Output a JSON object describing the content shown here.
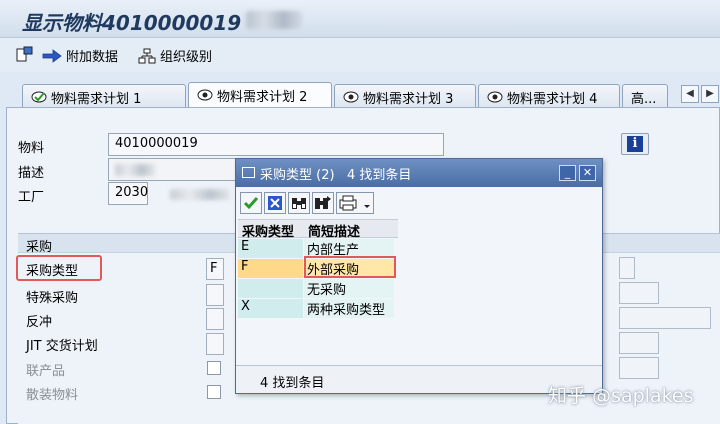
{
  "window": {
    "title": "显示物料4010000019"
  },
  "toolbar": {
    "items": [
      "附加数据",
      "组织级别"
    ]
  },
  "tabs": [
    "物料需求计划 1",
    "物料需求计划 2",
    "物料需求计划 3",
    "物料需求计划 4",
    "高..."
  ],
  "form": {
    "material_label": "物料",
    "material_value": "4010000019",
    "desc_label": "描述",
    "plant_label": "工厂",
    "plant_value": "2030"
  },
  "group": {
    "title": "采购",
    "fields": [
      "采购类型",
      "特殊采购",
      "反冲",
      "JIT 交货计划",
      "联产品",
      "散装物料"
    ],
    "proc_type_value": "F"
  },
  "popup": {
    "title": "采购类型 (2)",
    "found": "4 找到条目",
    "col_type": "采购类型",
    "col_desc": "简短描述",
    "rows": [
      {
        "type": "E",
        "desc": "内部生产"
      },
      {
        "type": "F",
        "desc": "外部采购"
      },
      {
        "type": "",
        "desc": "无采购"
      },
      {
        "type": "X",
        "desc": "两种采购类型"
      }
    ],
    "status": "4 找到条目"
  },
  "watermark": "知乎 @saplakes"
}
